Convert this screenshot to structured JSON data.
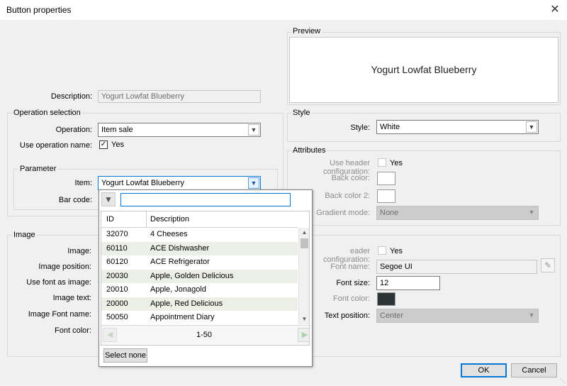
{
  "window": {
    "title": "Button properties",
    "close_glyph": "✕"
  },
  "description": {
    "label": "Description:",
    "value": "Yogurt Lowfat Blueberry"
  },
  "preview": {
    "group_label": "Preview",
    "text": "Yogurt Lowfat Blueberry"
  },
  "operation_selection": {
    "group_label": "Operation selection",
    "operation_label": "Operation:",
    "operation_value": "Item sale",
    "use_name_label": "Use operation name:",
    "use_name_checked": true,
    "use_name_text": "Yes"
  },
  "parameter": {
    "group_label": "Parameter",
    "item_label": "Item:",
    "item_value": "Yogurt Lowfat Blueberry",
    "barcode_label": "Bar code:"
  },
  "style": {
    "group_label": "Style",
    "style_label": "Style:",
    "style_value": "White"
  },
  "attributes": {
    "group_label": "Attributes",
    "use_header_label": "Use header configuration:",
    "use_header_text": "Yes",
    "back_color_label": "Back color:",
    "back_color2_label": "Back color 2:",
    "gradient_label": "Gradient mode:",
    "gradient_value": "None"
  },
  "image": {
    "group_label": "Image",
    "image_label": "Image:",
    "position_label": "Image position:",
    "font_as_image_label": "Use font as image:",
    "image_text_label": "Image text:",
    "image_font_label": "Image Font name:",
    "font_color_label": "Font color:"
  },
  "text_section": {
    "use_header_partial": "eader configuration:",
    "use_header_text": "Yes",
    "font_name_label": "Font name:",
    "font_name_value": "Segoe UI",
    "font_size_label": "Font size:",
    "font_size_value": "12",
    "font_color_label": "Font color:",
    "font_color": "#2d3436",
    "text_position_label": "Text position:",
    "text_position_value": "Center"
  },
  "dropdown": {
    "search_value": "",
    "columns": [
      "ID",
      "Description"
    ],
    "rows": [
      {
        "id": "32070",
        "desc": "4 Cheeses"
      },
      {
        "id": "60110",
        "desc": "ACE Dishwasher"
      },
      {
        "id": "60120",
        "desc": "ACE Refrigerator"
      },
      {
        "id": "20030",
        "desc": "Apple, Golden Delicious"
      },
      {
        "id": "20010",
        "desc": "Apple, Jonagold"
      },
      {
        "id": "20000",
        "desc": "Apple, Red Delicious"
      },
      {
        "id": "50050",
        "desc": "Appointment Diary"
      }
    ],
    "page_text": "1-50",
    "select_none": "Select none"
  },
  "buttons": {
    "ok": "OK",
    "cancel": "Cancel"
  },
  "colors": {
    "accent": "#0078d7",
    "alt_row": "#ecefe6",
    "window_bg": "#f0f0f0"
  }
}
